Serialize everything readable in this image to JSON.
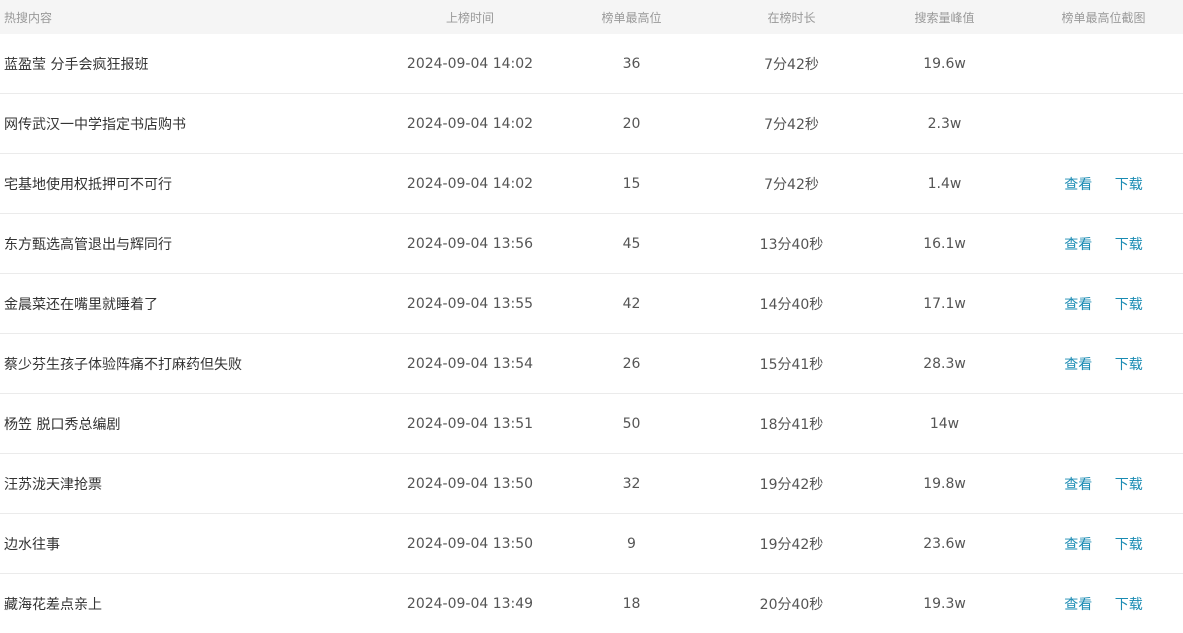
{
  "columns": [
    "热搜内容",
    "上榜时间",
    "榜单最高位",
    "在榜时长",
    "搜索量峰值",
    "榜单最高位截图"
  ],
  "rows": [
    {
      "title": "蓝盈莹 分手会疯狂报班",
      "time": "2024-09-04 14:02",
      "rank": "36",
      "duration": "7分42秒",
      "peak": "19.6w",
      "view": "",
      "download": ""
    },
    {
      "title": "网传武汉一中学指定书店购书",
      "time": "2024-09-04 14:02",
      "rank": "20",
      "duration": "7分42秒",
      "peak": "2.3w",
      "view": "",
      "download": ""
    },
    {
      "title": "宅基地使用权抵押可不可行",
      "time": "2024-09-04 14:02",
      "rank": "15",
      "duration": "7分42秒",
      "peak": "1.4w",
      "view": "查看",
      "download": "下载"
    },
    {
      "title": "东方甄选高管退出与辉同行",
      "time": "2024-09-04 13:56",
      "rank": "45",
      "duration": "13分40秒",
      "peak": "16.1w",
      "view": "查看",
      "download": "下载"
    },
    {
      "title": "金晨菜还在嘴里就睡着了",
      "time": "2024-09-04 13:55",
      "rank": "42",
      "duration": "14分40秒",
      "peak": "17.1w",
      "view": "查看",
      "download": "下载"
    },
    {
      "title": "蔡少芬生孩子体验阵痛不打麻药但失败",
      "time": "2024-09-04 13:54",
      "rank": "26",
      "duration": "15分41秒",
      "peak": "28.3w",
      "view": "查看",
      "download": "下载"
    },
    {
      "title": "杨笠 脱口秀总编剧",
      "time": "2024-09-04 13:51",
      "rank": "50",
      "duration": "18分41秒",
      "peak": "14w",
      "view": "",
      "download": ""
    },
    {
      "title": "汪苏泷天津抢票",
      "time": "2024-09-04 13:50",
      "rank": "32",
      "duration": "19分42秒",
      "peak": "19.8w",
      "view": "查看",
      "download": "下载"
    },
    {
      "title": "边水往事",
      "time": "2024-09-04 13:50",
      "rank": "9",
      "duration": "19分42秒",
      "peak": "23.6w",
      "view": "查看",
      "download": "下载"
    },
    {
      "title": "藏海花差点亲上",
      "time": "2024-09-04 13:49",
      "rank": "18",
      "duration": "20分40秒",
      "peak": "19.3w",
      "view": "查看",
      "download": "下载"
    }
  ],
  "colors": {
    "header_bg": "#f5f5f5",
    "header_text": "#999999",
    "link": "#1a8bb3",
    "row_border": "#ebebeb"
  }
}
